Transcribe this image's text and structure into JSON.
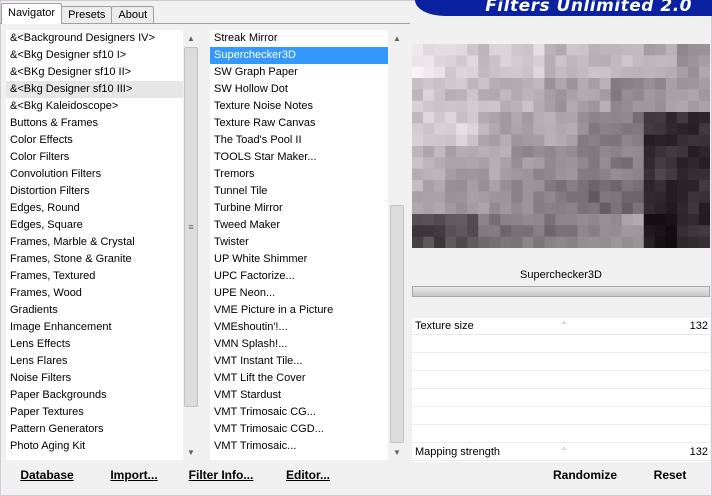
{
  "tabs": [
    "Navigator",
    "Presets",
    "About"
  ],
  "banner": {
    "title": "Filters Unlimited 2.0"
  },
  "categories": [
    "&<Background Designers IV>",
    "&<Bkg Designer sf10 I>",
    "&<BKg Designer sf10 II>",
    "&<Bkg Designer sf10 III>",
    "&<Bkg Kaleidoscope>",
    "Buttons & Frames",
    "Color Effects",
    "Color Filters",
    "Convolution Filters",
    "Distortion Filters",
    "Edges, Round",
    "Edges, Square",
    "Frames, Marble & Crystal",
    "Frames, Stone & Granite",
    "Frames, Textured",
    "Frames, Wood",
    "Gradients",
    "Image Enhancement",
    "Lens Effects",
    "Lens Flares",
    "Noise Filters",
    "Paper Backgrounds",
    "Paper Textures",
    "Pattern Generators",
    "Photo Aging Kit"
  ],
  "selected_category_index": 3,
  "filters": [
    "Streak Mirror",
    "Superchecker3D",
    "SW Graph Paper",
    "SW Hollow Dot",
    "Texture Noise Notes",
    "Texture Raw Canvas",
    "The Toad's Pool II",
    "TOOLS Star Maker...",
    "Tremors",
    "Tunnel Tile",
    "Turbine Mirror",
    "Tweed Maker",
    "Twister",
    "UP White Shimmer",
    "UPC Factorize...",
    "UPE Neon...",
    "VME Picture in a Picture",
    "VMEshoutin'!...",
    "VMN Splash!...",
    "VMT Instant Tile...",
    "VMT Lift the Cover",
    "VMT Stardust",
    "VMT Trimosaic CG...",
    "VMT Trimosaic CGD...",
    "VMT Trimosaic..."
  ],
  "selected_filter_index": 1,
  "filter_title": "Superchecker3D",
  "params": [
    {
      "label": "Texture size",
      "value": "132"
    },
    {
      "label": "Mapping strength",
      "value": "132"
    }
  ],
  "bottom_buttons": {
    "database": "Database",
    "import": "Import...",
    "filter_info": "Filter Info...",
    "editor": "Editor...",
    "randomize": "Randomize",
    "reset": "Reset"
  },
  "icons": {
    "scroll_up": "scroll-up-arrow-icon",
    "scroll_down": "scroll-down-arrow-icon",
    "grip": "grip-icon",
    "drag_handle": "drag-handle-icon"
  },
  "colors": {
    "selection_blue": "#3399ff",
    "banner_blue": "#0b22a0"
  }
}
